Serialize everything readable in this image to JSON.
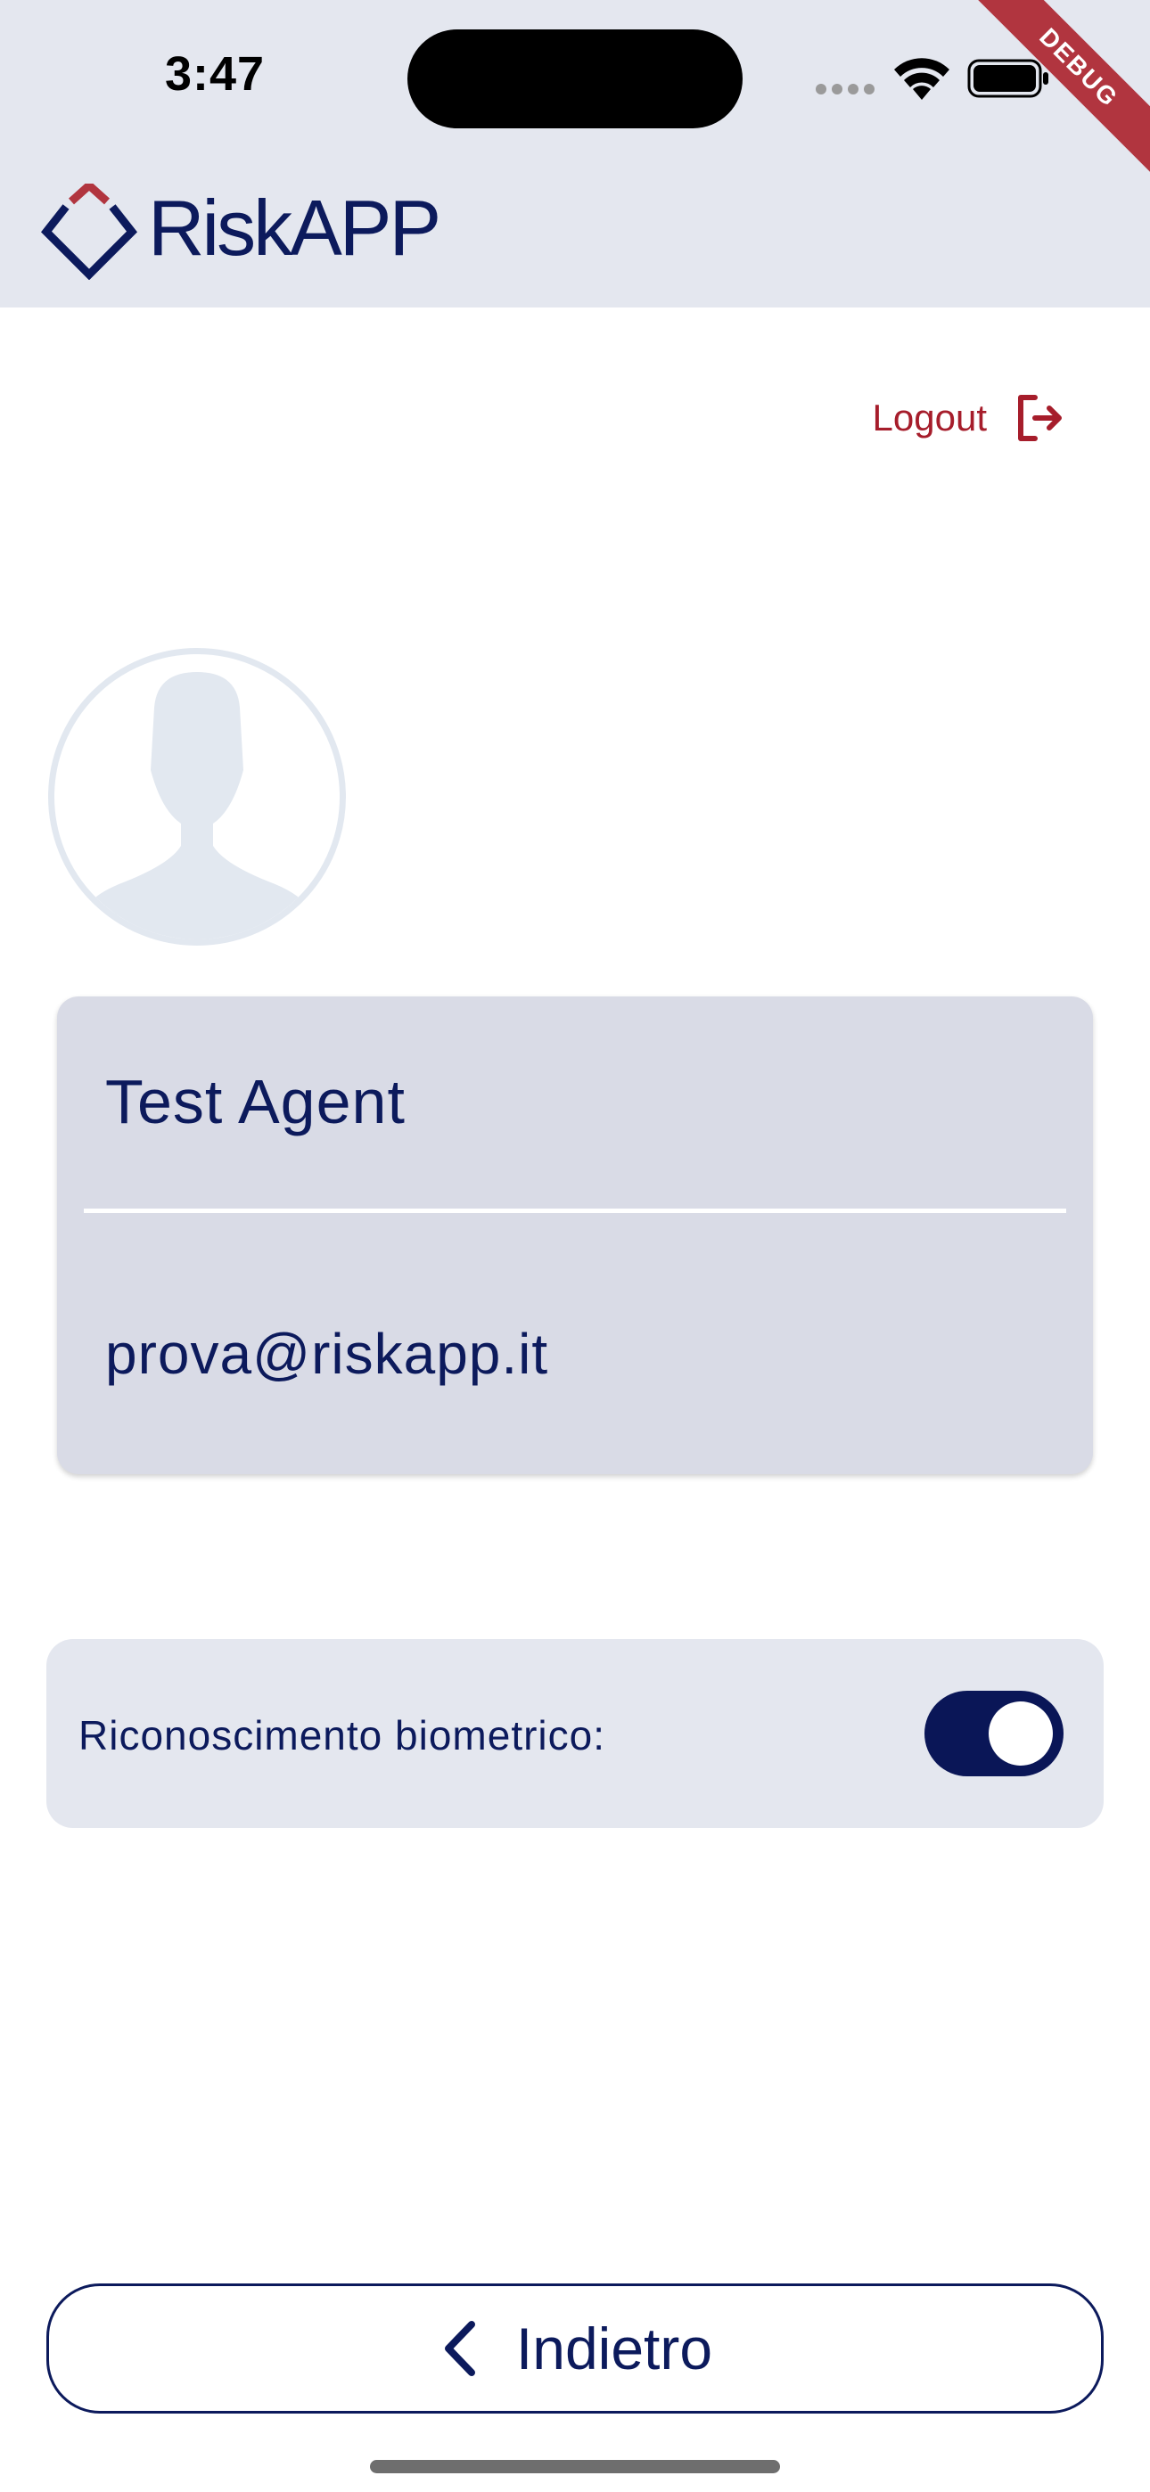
{
  "status_bar": {
    "time": "3:47"
  },
  "debug_label": "DEBUG",
  "header": {
    "logo_text": "RiskAPP"
  },
  "logout": {
    "label": "Logout"
  },
  "profile": {
    "name": "Test Agent",
    "email": "prova@riskapp.it"
  },
  "settings": {
    "biometric_label": "Riconoscimento biometrico:",
    "biometric_enabled": true
  },
  "footer": {
    "back_label": "Indietro"
  },
  "colors": {
    "primary": "#0c1a5c",
    "accent_red": "#a61d2b",
    "header_bg": "#e4e7ef",
    "card_bg": "#d9dbe6",
    "avatar_placeholder": "#e2e8f0"
  }
}
